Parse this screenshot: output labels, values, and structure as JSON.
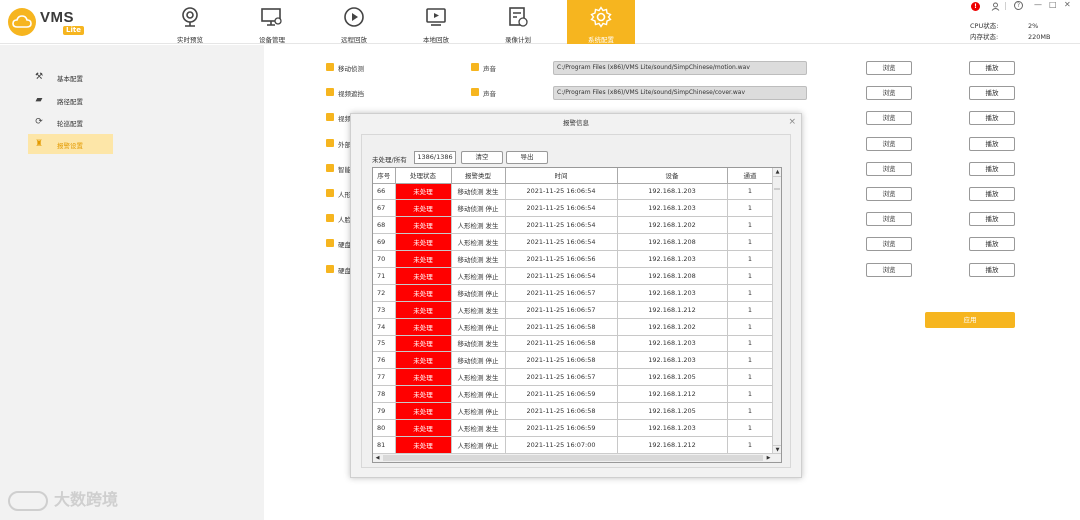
{
  "app": {
    "logo_text": "VMS",
    "logo_badge": "Lite"
  },
  "nav": [
    {
      "label": "实时预览",
      "icon": "webcam-icon"
    },
    {
      "label": "设备管理",
      "icon": "monitor-gear-icon"
    },
    {
      "label": "远程回放",
      "icon": "play-circle-icon"
    },
    {
      "label": "本地回放",
      "icon": "tv-play-icon"
    },
    {
      "label": "录像计划",
      "icon": "calendar-clock-icon"
    },
    {
      "label": "系统配置",
      "icon": "gear-icon",
      "active": true
    }
  ],
  "window_controls": {
    "alert": "!",
    "user": "user-icon",
    "help": "?",
    "minimize": "—",
    "maximize": "□",
    "close": "✕"
  },
  "status": {
    "cpu_label": "CPU状态:",
    "cpu_value": "2%",
    "mem_label": "内存状态:",
    "mem_value": "220MB"
  },
  "sidebar": [
    {
      "label": "基本配置",
      "icon": "wrench-icon"
    },
    {
      "label": "路径配置",
      "icon": "folder-icon"
    },
    {
      "label": "轮巡配置",
      "icon": "cycle-icon"
    },
    {
      "label": "报警设置",
      "icon": "alarm-icon",
      "active": true
    }
  ],
  "watermark": "大数跨境",
  "settings": {
    "rows": [
      {
        "label1": "移动侦测",
        "label2": "声音",
        "path": "C:/Program Files (x86)/VMS Lite/sound/SimpChinese/motion.wav",
        "browse": "浏览",
        "play": "播放"
      },
      {
        "label1": "视频遮挡",
        "label2": "声音",
        "path": "C:/Program Files (x86)/VMS Lite/sound/SimpChinese/cover.wav",
        "browse": "浏览",
        "play": "播放"
      },
      {
        "label1": "视频",
        "label2": "",
        "path": "",
        "browse": "浏览",
        "play": "播放"
      },
      {
        "label1": "外部",
        "label2": "",
        "path": "",
        "browse": "浏览",
        "play": "播放"
      },
      {
        "label1": "智能",
        "label2": "",
        "path": "",
        "browse": "浏览",
        "play": "播放"
      },
      {
        "label1": "人形",
        "label2": "",
        "path": "",
        "browse": "浏览",
        "play": "播放"
      },
      {
        "label1": "人脸",
        "label2": "",
        "path": "",
        "browse": "浏览",
        "play": "播放"
      },
      {
        "label1": "硬盘",
        "label2": "",
        "path": "",
        "browse": "浏览",
        "play": "播放"
      },
      {
        "label1": "硬盘",
        "label2": "",
        "path": "",
        "browse": "浏览",
        "play": "播放"
      }
    ],
    "apply": "应用"
  },
  "dialog": {
    "title": "报警信息",
    "close": "×",
    "count_label": "未处理/所有",
    "count_value": "1386/1386",
    "clear_btn": "清空",
    "export_btn": "导出",
    "columns": [
      "序号",
      "处理状态",
      "报警类型",
      "时间",
      "设备",
      "通道"
    ],
    "rows": [
      [
        "66",
        "未处理",
        "移动侦测 发生",
        "2021-11-25 16:06:54",
        "192.168.1.203",
        "1"
      ],
      [
        "67",
        "未处理",
        "移动侦测 停止",
        "2021-11-25 16:06:54",
        "192.168.1.203",
        "1"
      ],
      [
        "68",
        "未处理",
        "人形检测 发生",
        "2021-11-25 16:06:54",
        "192.168.1.202",
        "1"
      ],
      [
        "69",
        "未处理",
        "人形检测 发生",
        "2021-11-25 16:06:54",
        "192.168.1.208",
        "1"
      ],
      [
        "70",
        "未处理",
        "移动侦测 发生",
        "2021-11-25 16:06:56",
        "192.168.1.203",
        "1"
      ],
      [
        "71",
        "未处理",
        "人形检测 停止",
        "2021-11-25 16:06:54",
        "192.168.1.208",
        "1"
      ],
      [
        "72",
        "未处理",
        "移动侦测 停止",
        "2021-11-25 16:06:57",
        "192.168.1.203",
        "1"
      ],
      [
        "73",
        "未处理",
        "人形检测 发生",
        "2021-11-25 16:06:57",
        "192.168.1.212",
        "1"
      ],
      [
        "74",
        "未处理",
        "人形检测 停止",
        "2021-11-25 16:06:58",
        "192.168.1.202",
        "1"
      ],
      [
        "75",
        "未处理",
        "移动侦测 发生",
        "2021-11-25 16:06:58",
        "192.168.1.203",
        "1"
      ],
      [
        "76",
        "未处理",
        "移动侦测 停止",
        "2021-11-25 16:06:58",
        "192.168.1.203",
        "1"
      ],
      [
        "77",
        "未处理",
        "人形检测 发生",
        "2021-11-25 16:06:57",
        "192.168.1.205",
        "1"
      ],
      [
        "78",
        "未处理",
        "人形检测 停止",
        "2021-11-25 16:06:59",
        "192.168.1.212",
        "1"
      ],
      [
        "79",
        "未处理",
        "人形检测 停止",
        "2021-11-25 16:06:58",
        "192.168.1.205",
        "1"
      ],
      [
        "80",
        "未处理",
        "人形检测 发生",
        "2021-11-25 16:06:59",
        "192.168.1.203",
        "1"
      ],
      [
        "81",
        "未处理",
        "人形检测 停止",
        "2021-11-25 16:07:00",
        "192.168.1.212",
        "1"
      ]
    ]
  },
  "colors": {
    "accent": "#f6b51f",
    "unprocessed": "#ff0000"
  }
}
